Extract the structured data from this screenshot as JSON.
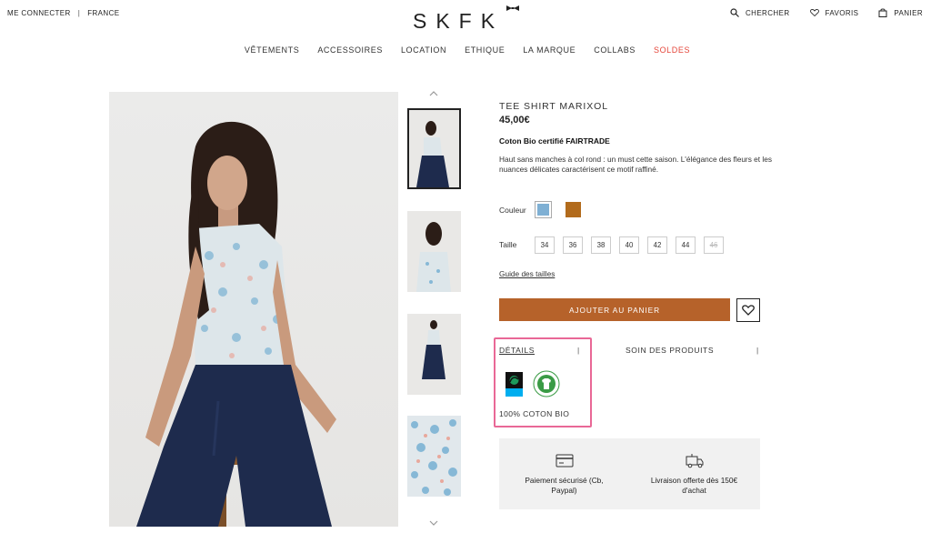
{
  "header": {
    "login": "ME CONNECTER",
    "separator": "|",
    "country": "FRANCE",
    "logo": "SKFK",
    "search": "CHERCHER",
    "favorites": "FAVORIS",
    "cart": "PANIER"
  },
  "nav": {
    "items": [
      "VÊTEMENTS",
      "ACCESSOIRES",
      "LOCATION",
      "ETHIQUE",
      "LA MARQUE",
      "COLLABS",
      "SOLDES"
    ],
    "sale_color": "#e5463a"
  },
  "product": {
    "title": "TEE SHIRT MARIXOL",
    "price": "45,00€",
    "subtitle": "Coton Bio certifié FAIRTRADE",
    "description": "Haut sans manches à col rond : un must cette saison. L'élégance des fleurs et les nuances délicates caractérisent ce motif raffiné.",
    "color_label": "Couleur",
    "colors": [
      "#7fb0d4",
      "#b26b1c"
    ],
    "size_label": "Taille",
    "sizes": [
      "34",
      "36",
      "38",
      "40",
      "42",
      "44",
      "46"
    ],
    "size_unavailable": "46",
    "size_guide": "Guide des tailles",
    "add_to_cart": "AJOUTER AU PANIER",
    "add_to_cart_color": "#b6622a"
  },
  "tabs": {
    "details": "DÉTAILS",
    "care": "SOIN DES PRODUITS",
    "separator": "|",
    "details_text": "100% COTON BIO",
    "highlight_color": "#e96896"
  },
  "info": {
    "payment": "Paiement sécurisé (Cb, Paypal)",
    "delivery": "Livraison offerte dès 150€ d'achat"
  }
}
